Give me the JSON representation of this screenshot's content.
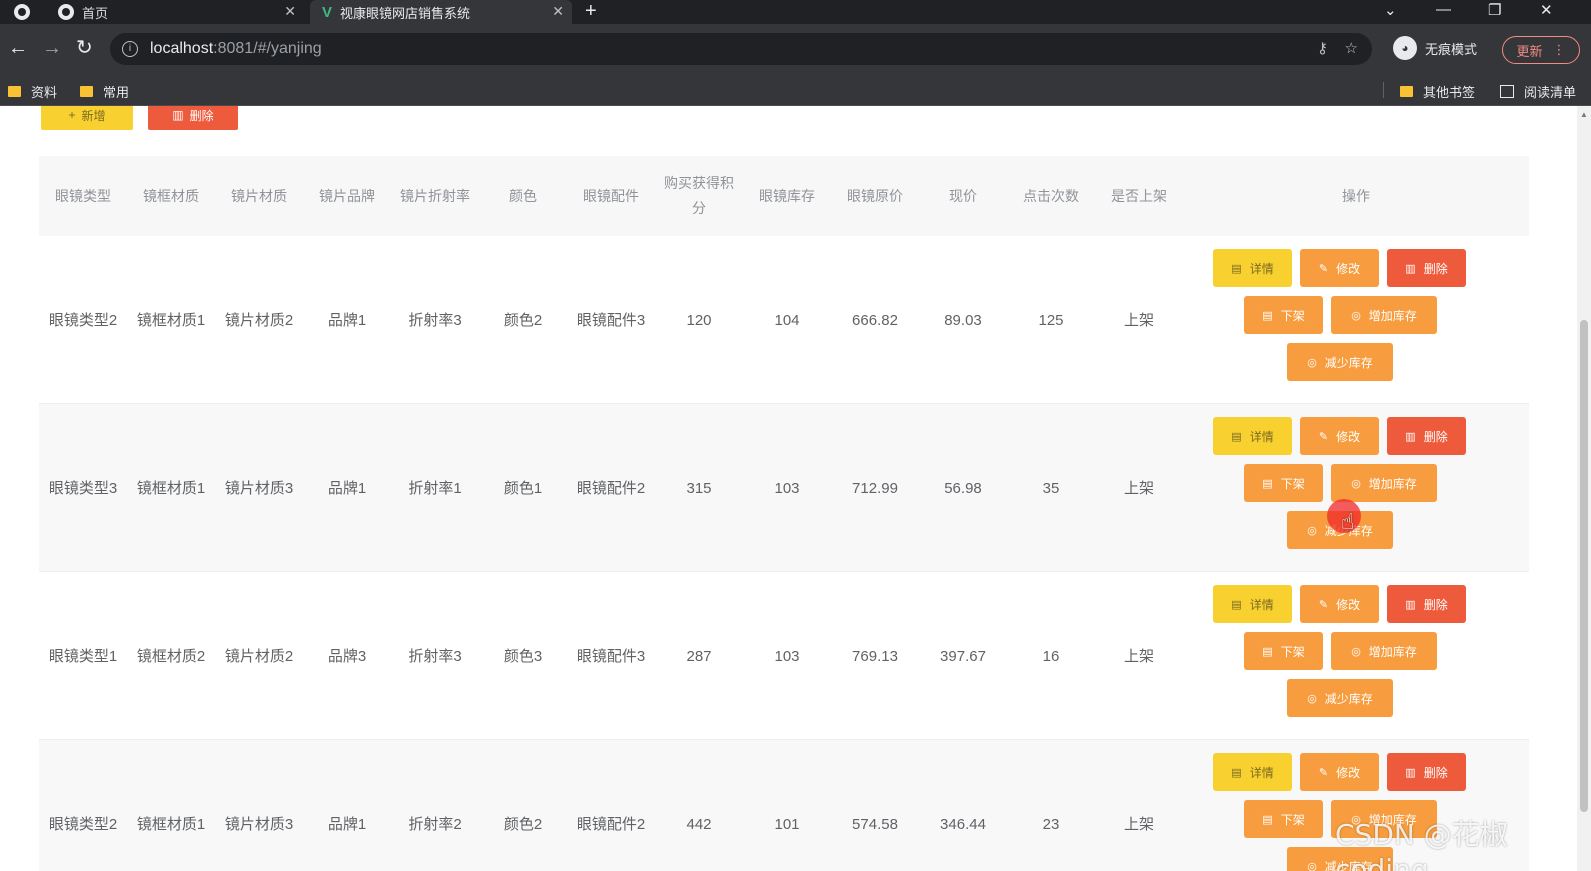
{
  "browser": {
    "tabs": [
      {
        "title": "首页"
      },
      {
        "title": "视康眼镜网店销售系统"
      }
    ],
    "url_host": "localhost",
    "url_path": ":8081/#/yanjing",
    "incognito_label": "无痕模式",
    "update_label": "更新",
    "bookmarks": [
      "资料",
      "常用",
      "其他书签",
      "阅读清单"
    ]
  },
  "toolbar": {
    "add_label": "新增",
    "delete_label": "删除"
  },
  "table": {
    "columns": [
      "眼镜类型",
      "镜框材质",
      "镜片材质",
      "镜片品牌",
      "镜片折射率",
      "颜色",
      "眼镜配件",
      "购买获得积分",
      "眼镜库存",
      "眼镜原价",
      "现价",
      "点击次数",
      "是否上架",
      "操作"
    ],
    "rows": [
      {
        "type": "眼镜类型2",
        "frame": "镜框材质1",
        "lens": "镜片材质2",
        "brand": "品牌1",
        "index": "折射率3",
        "color": "颜色2",
        "accessory": "眼镜配件3",
        "points": "120",
        "stock": "104",
        "orig_price": "666.82",
        "price": "89.03",
        "clicks": "125",
        "listed": "上架"
      },
      {
        "type": "眼镜类型3",
        "frame": "镜框材质1",
        "lens": "镜片材质3",
        "brand": "品牌1",
        "index": "折射率1",
        "color": "颜色1",
        "accessory": "眼镜配件2",
        "points": "315",
        "stock": "103",
        "orig_price": "712.99",
        "price": "56.98",
        "clicks": "35",
        "listed": "上架"
      },
      {
        "type": "眼镜类型1",
        "frame": "镜框材质2",
        "lens": "镜片材质2",
        "brand": "品牌3",
        "index": "折射率3",
        "color": "颜色3",
        "accessory": "眼镜配件3",
        "points": "287",
        "stock": "103",
        "orig_price": "769.13",
        "price": "397.67",
        "clicks": "16",
        "listed": "上架"
      },
      {
        "type": "眼镜类型2",
        "frame": "镜框材质1",
        "lens": "镜片材质3",
        "brand": "品牌1",
        "index": "折射率2",
        "color": "颜色2",
        "accessory": "眼镜配件2",
        "points": "442",
        "stock": "101",
        "orig_price": "574.58",
        "price": "346.44",
        "clicks": "23",
        "listed": "上架"
      }
    ],
    "actions": {
      "detail": "详情",
      "edit": "修改",
      "delete": "删除",
      "unlist": "下架",
      "add_stock": "增加库存",
      "reduce_stock": "减少库存"
    }
  },
  "watermark": "CSDN @花椒coding",
  "colors": {
    "yellow_button": "#f8d130",
    "orange_button": "#f79d3f",
    "red_button": "#ee5b3c",
    "chrome_dark": "#35363a"
  }
}
